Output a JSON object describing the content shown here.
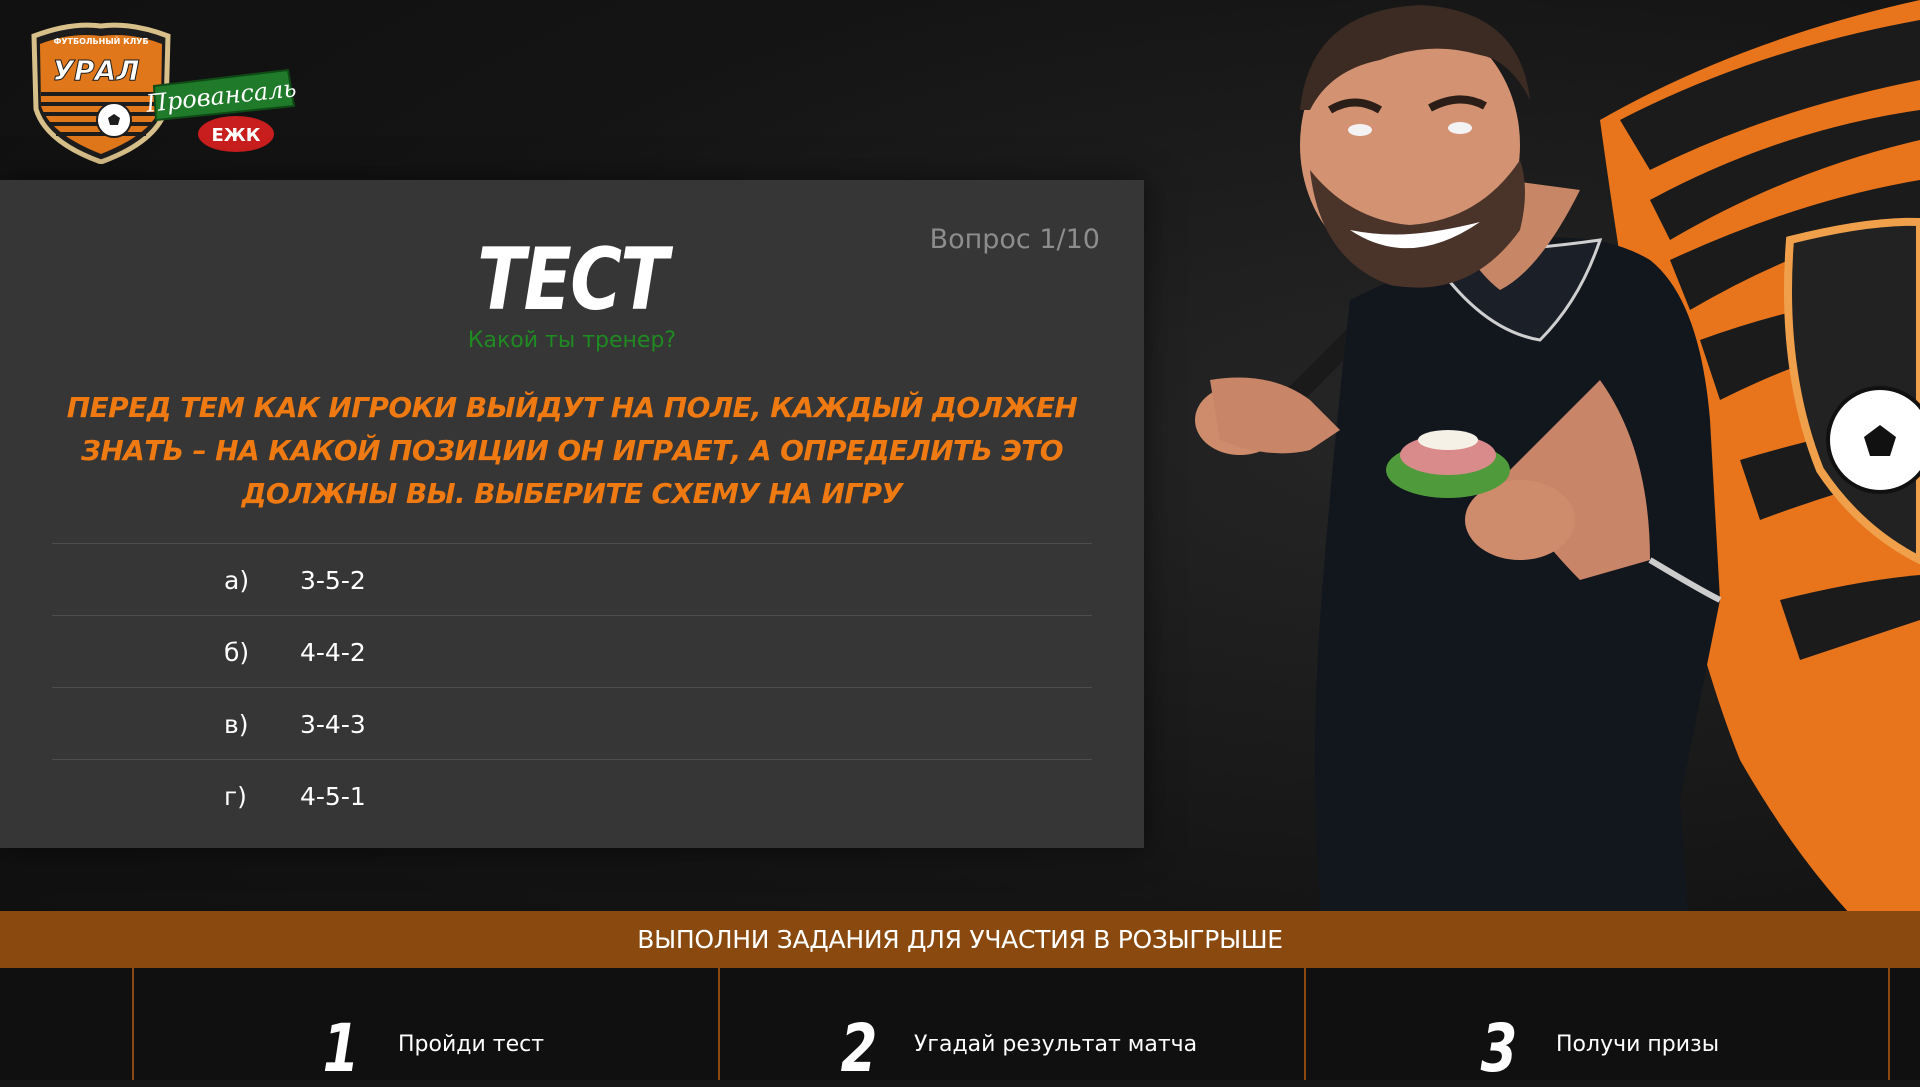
{
  "logo": {
    "club_top": "ФУТБОЛЬНЫЙ КЛУБ",
    "club_name": "УРАЛ",
    "sponsor": "Провансаль",
    "sponsor_badge": "ЕЖК"
  },
  "quiz": {
    "title": "ТЕСТ",
    "counter": "Вопрос 1/10",
    "subtitle": "Какой ты тренер?",
    "question": "Перед тем как игроки выйдут на поле, каждый должен знать – на какой позиции он играет, а определить это должны вы. Выберите схему на игру",
    "answers": [
      {
        "letter": "а)",
        "value": "3-5-2"
      },
      {
        "letter": "б)",
        "value": "4-4-2"
      },
      {
        "letter": "в)",
        "value": "3-4-3"
      },
      {
        "letter": "г)",
        "value": "4-5-1"
      }
    ]
  },
  "banner": {
    "text": "ВЫПОЛНИ ЗАДАНИЯ ДЛЯ УЧАСТИЯ В РОЗЫГРЫШЕ"
  },
  "steps": [
    {
      "num": "1",
      "label": "Пройди тест"
    },
    {
      "num": "2",
      "label": "Угадай результат матча"
    },
    {
      "num": "3",
      "label": "Получи призы"
    }
  ],
  "colors": {
    "accent": "#f07a12",
    "banner": "#8a4a0f",
    "panel": "#363636",
    "subtitle": "#1f8a22",
    "counter": "#8d8d8d"
  }
}
